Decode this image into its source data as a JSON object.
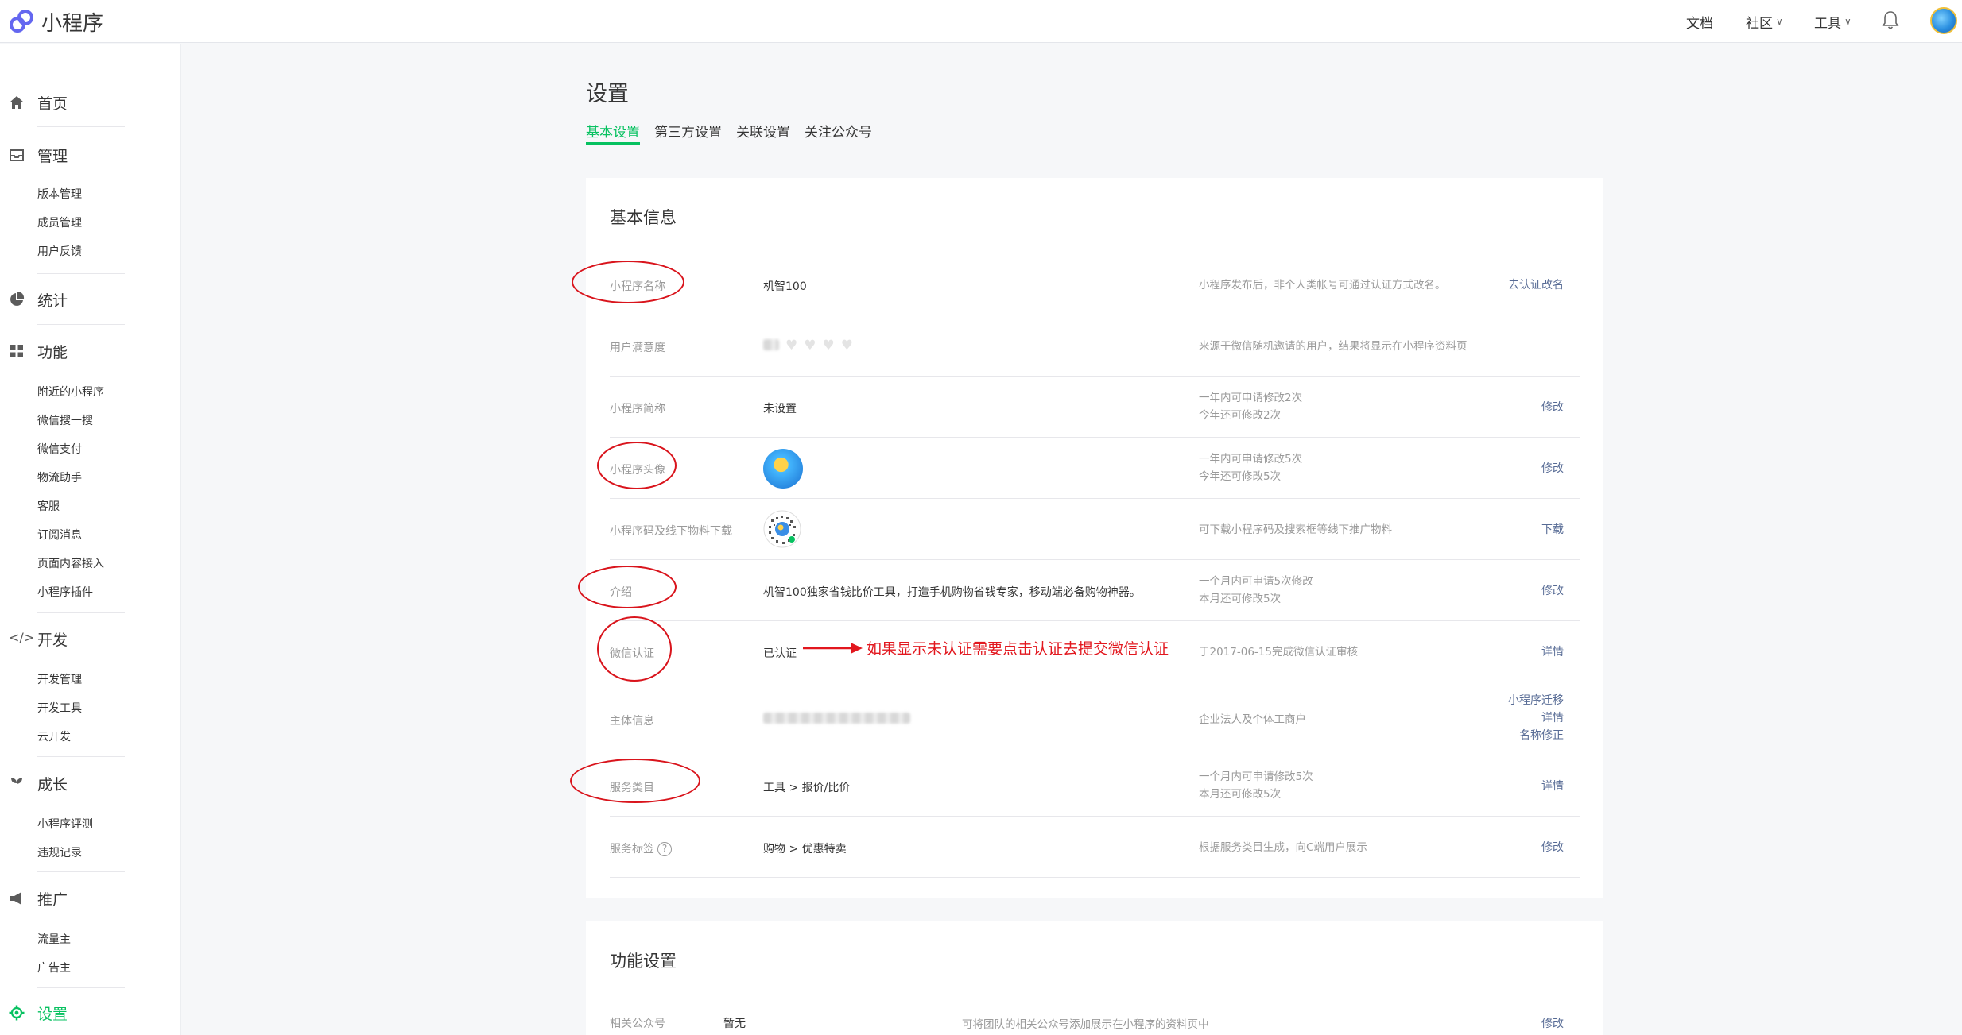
{
  "header": {
    "app_name": "小程序",
    "nav": {
      "docs": "文档",
      "community": "社区",
      "tools": "工具"
    },
    "icons": {
      "logo": "miniprogram-logo",
      "bell": "bell-icon",
      "avatar": "avatar"
    }
  },
  "sidebar": {
    "home": "首页",
    "manage": {
      "label": "管理",
      "items": [
        "版本管理",
        "成员管理",
        "用户反馈"
      ]
    },
    "stats": "统计",
    "features": {
      "label": "功能",
      "items": [
        "附近的小程序",
        "微信搜一搜",
        "微信支付",
        "物流助手",
        "客服",
        "订阅消息",
        "页面内容接入",
        "小程序插件"
      ]
    },
    "develop": {
      "label": "开发",
      "items": [
        "开发管理",
        "开发工具",
        "云开发"
      ]
    },
    "growth": {
      "label": "成长",
      "items": [
        "小程序评测",
        "违规记录"
      ]
    },
    "promote": {
      "label": "推广",
      "items": [
        "流量主",
        "广告主"
      ]
    },
    "settings": "设置"
  },
  "main": {
    "title": "设置",
    "tabs": [
      "基本设置",
      "第三方设置",
      "关联设置",
      "关注公众号"
    ],
    "basic_info": {
      "title": "基本信息",
      "rows": [
        {
          "label": "小程序名称",
          "value": "机智100",
          "desc": "小程序发布后，非个人类帐号可通过认证方式改名。",
          "action": "去认证改名"
        },
        {
          "label": "用户满意度",
          "value": "",
          "desc": "来源于微信随机邀请的用户，结果将显示在小程序资料页",
          "action": ""
        },
        {
          "label": "小程序简称",
          "value": "未设置",
          "desc1": "一年内可申请修改2次",
          "desc2": "今年还可修改2次",
          "action": "修改"
        },
        {
          "label": "小程序头像",
          "value": "",
          "desc1": "一年内可申请修改5次",
          "desc2": "今年还可修改5次",
          "action": "修改"
        },
        {
          "label": "小程序码及线下物料下载",
          "value": "",
          "desc": "可下载小程序码及搜索框等线下推广物料",
          "action": "下载"
        },
        {
          "label": "介绍",
          "value": "机智100独家省钱比价工具，打造手机购物省钱专家，移动端必备购物神器。",
          "desc1": "一个月内可申请5次修改",
          "desc2": "本月还可修改5次",
          "action": "修改"
        },
        {
          "label": "微信认证",
          "value": "已认证",
          "desc": "于2017-06-15完成微信认证审核",
          "action": "详情"
        },
        {
          "label": "主体信息",
          "value": "",
          "desc": "企业法人及个体工商户",
          "actions": [
            "小程序迁移",
            "详情",
            "名称修正"
          ]
        },
        {
          "label": "服务类目",
          "value": "工具 > 报价/比价",
          "desc1": "一个月内可申请修改5次",
          "desc2": "本月还可修改5次",
          "action": "详情"
        },
        {
          "label": "服务标签",
          "value": "购物 > 优惠特卖",
          "desc": "根据服务类目生成，向C端用户展示",
          "action": "修改"
        }
      ]
    },
    "annotation": "如果显示未认证需要点击认证去提交微信认证",
    "feature_settings": {
      "title": "功能设置",
      "row": {
        "label": "相关公众号",
        "value": "暂无",
        "desc": "可将团队的相关公众号添加展示在小程序的资料页中",
        "action": "修改"
      }
    },
    "colors": {
      "accent": "#07c160",
      "link": "#576b95",
      "annotation": "#d9141c"
    }
  }
}
